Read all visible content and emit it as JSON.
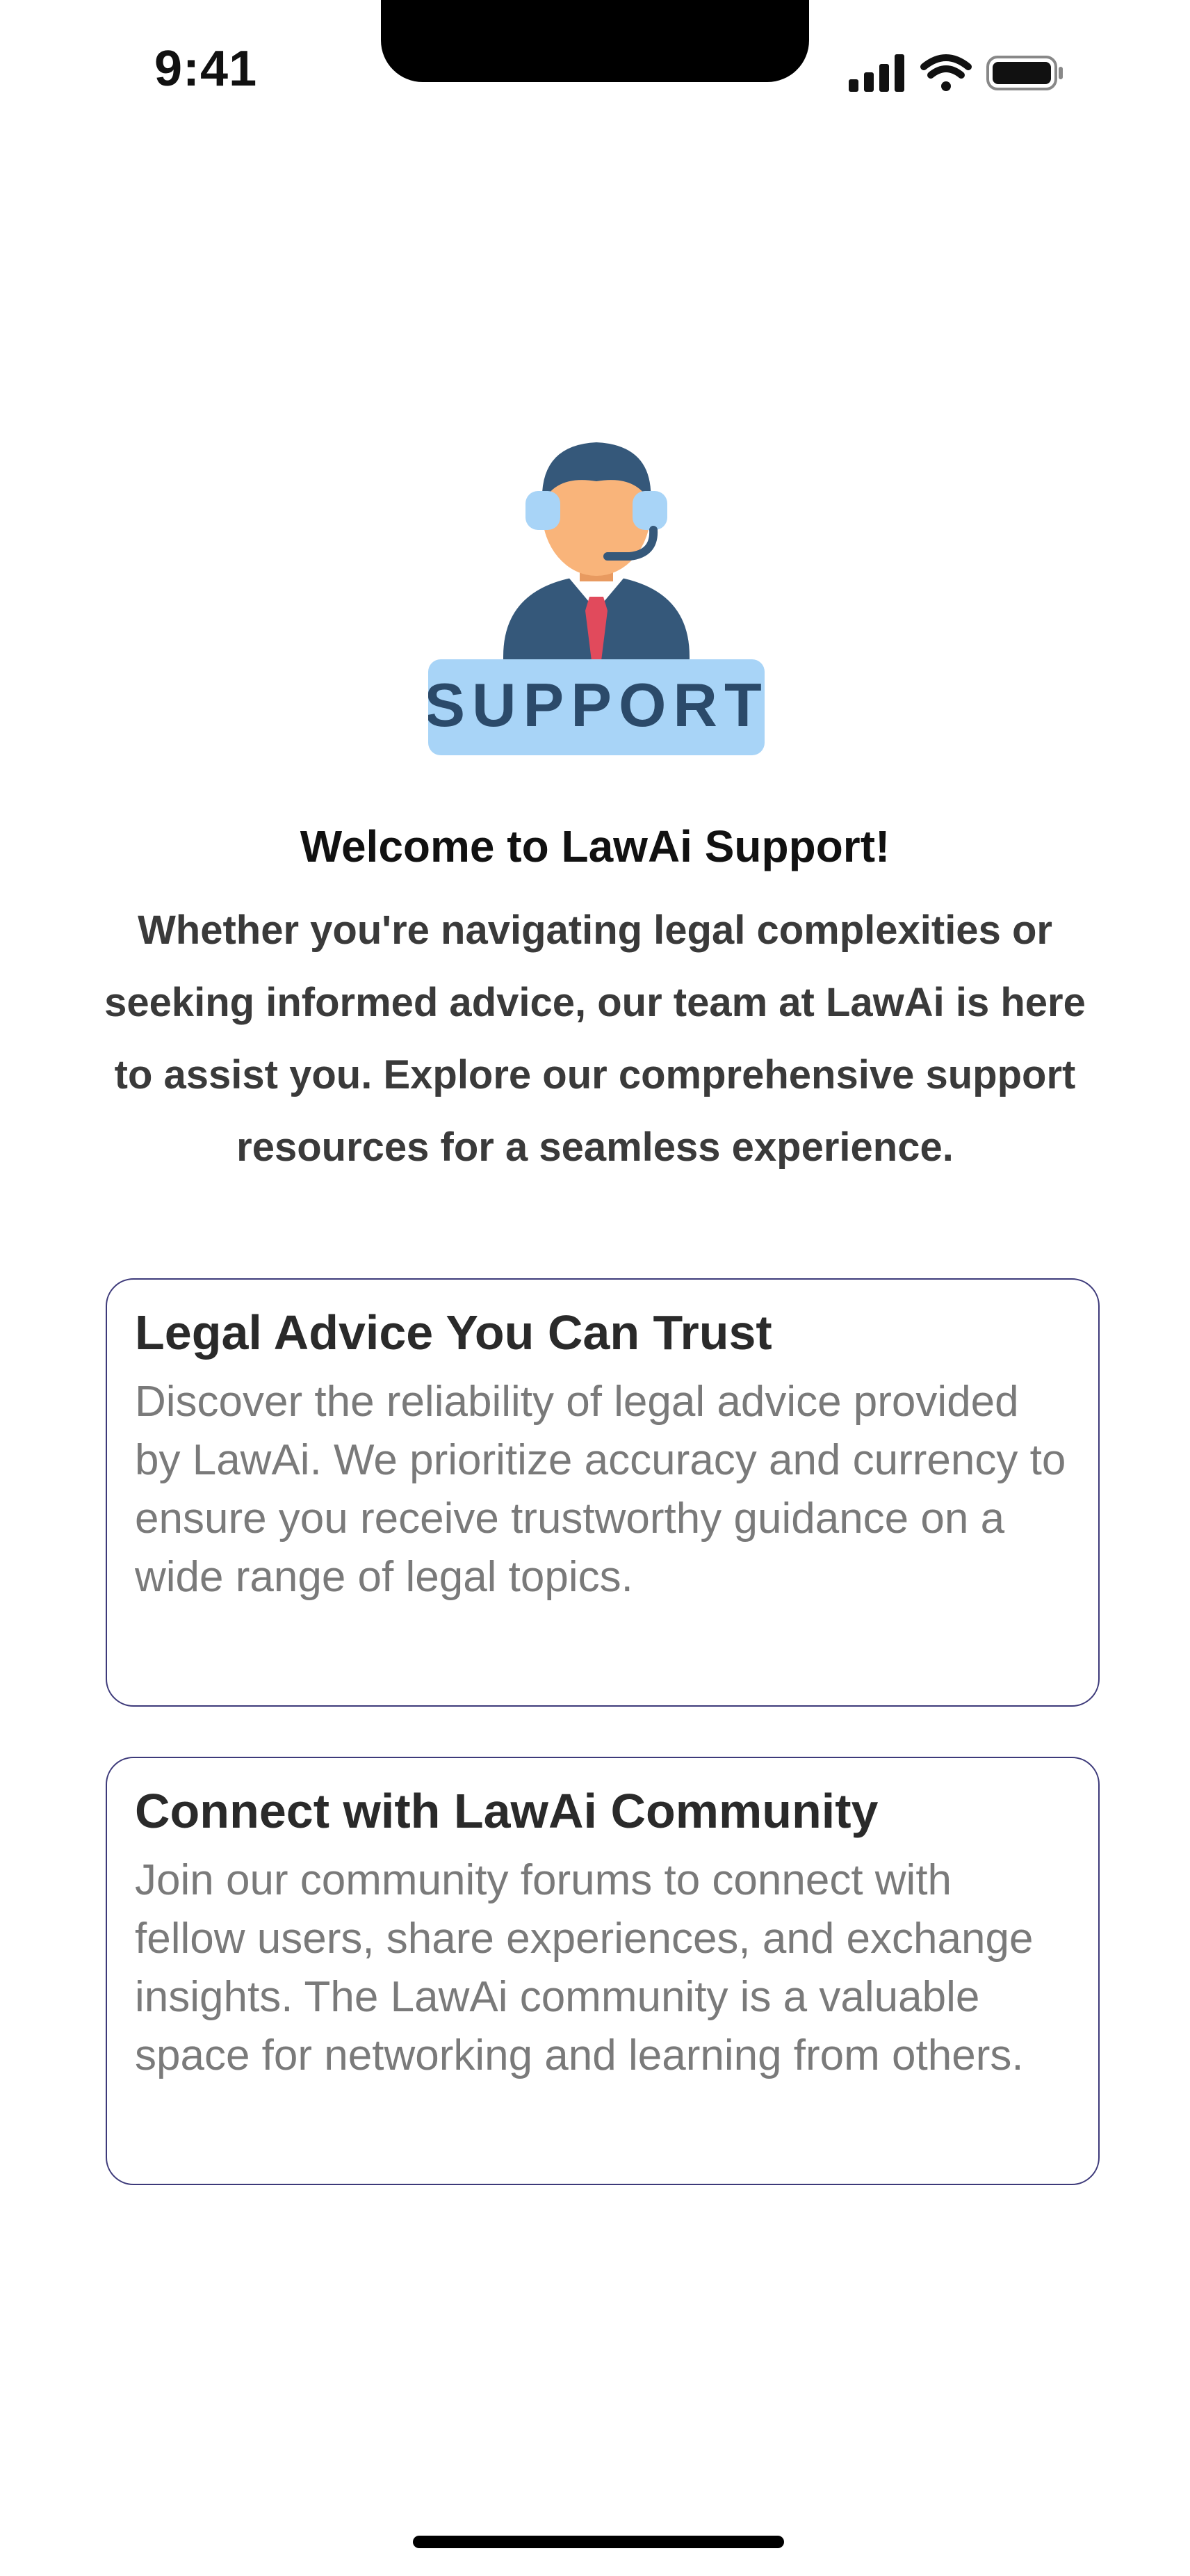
{
  "status_bar": {
    "time": "9:41",
    "icons": [
      "signal-icon",
      "wifi-icon",
      "battery-icon"
    ]
  },
  "hero": {
    "illustration": "support-agent-icon",
    "badge_text": "SUPPORT",
    "colors": {
      "hair": "#35587a",
      "skin": "#f9b47a",
      "suit": "#35587a",
      "tie": "#e14a5c",
      "badge": "#a8d4f7",
      "headset": "#a8d4f7"
    }
  },
  "welcome": {
    "title": "Welcome to LawAi Support!",
    "body": "Whether you're navigating legal complexities or seeking informed advice, our team at LawAi is here to assist you. Explore our comprehensive support resources for a seamless experience."
  },
  "cards": [
    {
      "title": "Legal Advice You Can Trust",
      "text": "Discover the reliability of legal advice provided by LawAi. We prioritize accuracy and currency to ensure you receive trustworthy guidance on a wide range of legal topics."
    },
    {
      "title": "Connect with LawAi Community",
      "text": "Join our community forums to connect with fellow users, share experiences, and exchange insights. The LawAi community is a valuable space for networking and learning from others."
    }
  ],
  "colors": {
    "card_border": "#3d3a7a",
    "card_text": "#7a7a7a",
    "heading": "#111111"
  }
}
